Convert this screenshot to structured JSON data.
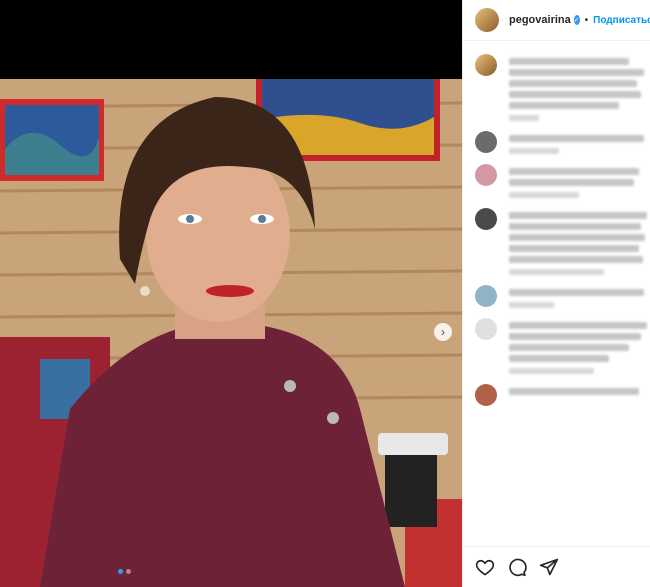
{
  "header": {
    "username": "pegovairina",
    "separator": "•",
    "follow_label": "Подписаться"
  },
  "media": {
    "carousel_position": 1,
    "carousel_count": 2
  },
  "actions": {
    "like_icon": "heart-icon",
    "comment_icon": "comment-icon",
    "share_icon": "share-icon"
  },
  "colors": {
    "accent": "#0095f6",
    "verified": "#3897f0"
  }
}
